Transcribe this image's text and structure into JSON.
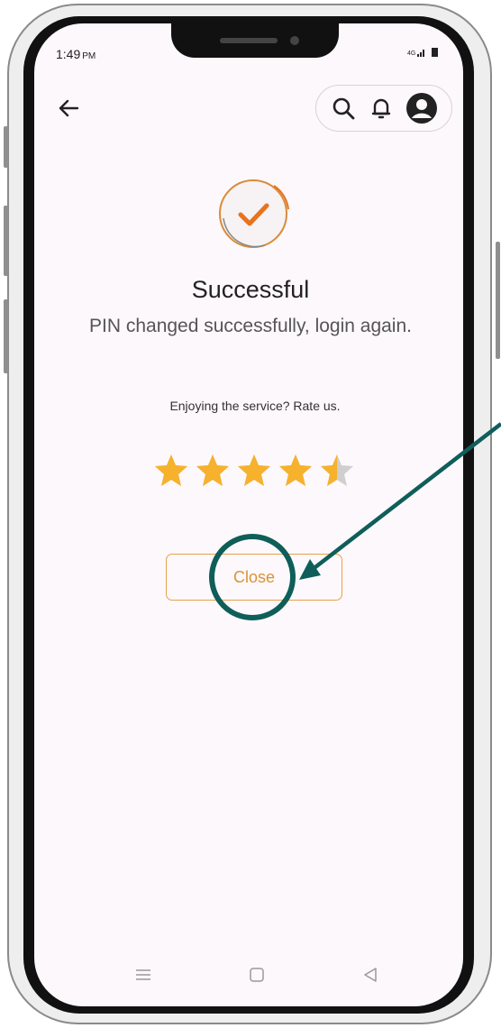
{
  "status_bar": {
    "time": "1:49",
    "ampm": "PM",
    "signal_text": "4G"
  },
  "header": {
    "back_icon": "arrow-left-icon",
    "search_icon": "search-icon",
    "bell_icon": "bell-icon",
    "profile_icon": "user-avatar-icon"
  },
  "result": {
    "icon": "check-circle-icon",
    "title": "Successful",
    "message": "PIN changed successfully, login again."
  },
  "rating": {
    "prompt": "Enjoying the service? Rate us.",
    "value": 4.5,
    "max": 5
  },
  "actions": {
    "close_label": "Close"
  },
  "colors": {
    "accent": "#e8731c",
    "star": "#f6b12d",
    "button_border": "#e4a24a",
    "annotation": "#0f5e5a"
  }
}
